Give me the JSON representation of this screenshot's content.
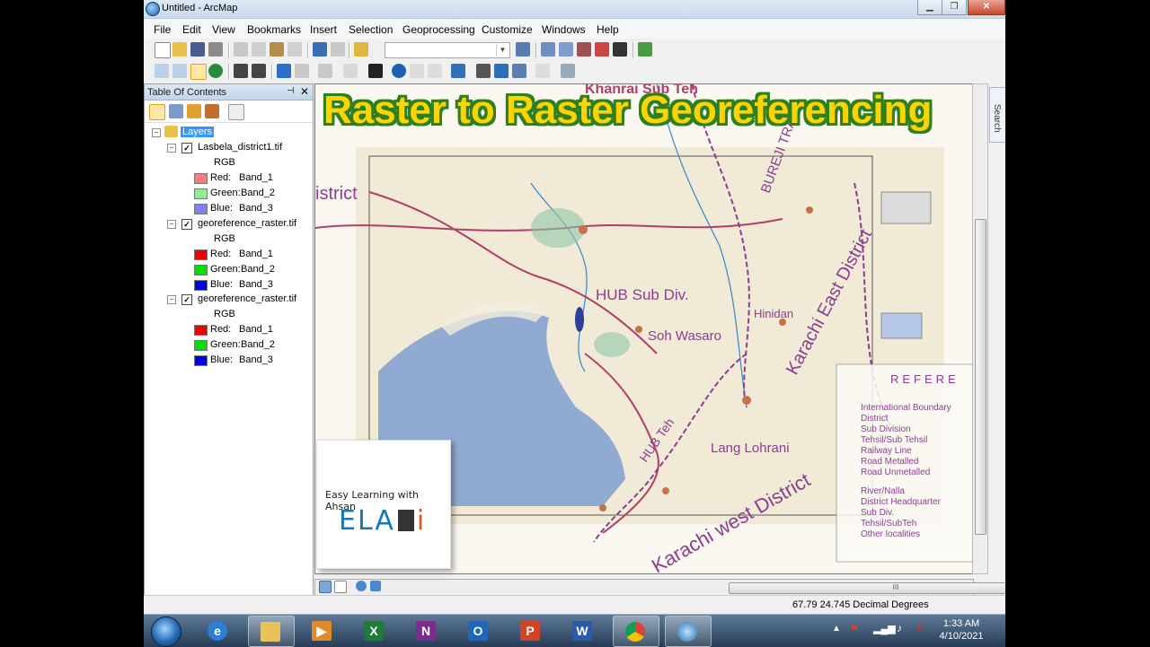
{
  "window": {
    "title": "Untitled - ArcMap",
    "minimize": "▁",
    "maximize": "❐",
    "close": "✕"
  },
  "menu": [
    "File",
    "Edit",
    "View",
    "Bookmarks",
    "Insert",
    "Selection",
    "Geoprocessing",
    "Customize",
    "Windows",
    "Help"
  ],
  "toc": {
    "title": "Table Of Contents",
    "pin": "⊣",
    "close": "✕",
    "root": "Layers",
    "layers": [
      {
        "name": "Lasbela_district1.tif",
        "renderer": "RGB",
        "bands": [
          {
            "label": "Red:",
            "band": "Band_1",
            "color": "#f08080"
          },
          {
            "label": "Green:",
            "band": "Band_2",
            "color": "#90ee90"
          },
          {
            "label": "Blue:",
            "band": "Band_3",
            "color": "#8080f0"
          }
        ]
      },
      {
        "name": "georeference_raster.tif",
        "renderer": "RGB",
        "bands": [
          {
            "label": "Red:",
            "band": "Band_1",
            "color": "#ee0000"
          },
          {
            "label": "Green:",
            "band": "Band_2",
            "color": "#00dd00"
          },
          {
            "label": "Blue:",
            "band": "Band_3",
            "color": "#0000dd"
          }
        ]
      },
      {
        "name": "georeference_raster.tif",
        "renderer": "RGB",
        "bands": [
          {
            "label": "Red:",
            "band": "Band_1",
            "color": "#ee0000"
          },
          {
            "label": "Green:",
            "band": "Band_2",
            "color": "#00dd00"
          },
          {
            "label": "Blue:",
            "band": "Band_3",
            "color": "#0000dd"
          }
        ]
      }
    ]
  },
  "map": {
    "banner": "Raster to Raster Georeferencing",
    "labels": {
      "khanrai": "Khanrai Sub Teh",
      "district": "istrict",
      "burejitrak": "BUREJI TRAK",
      "hub": "HUB Sub Div.",
      "sohwasaro": "Soh Wasaro",
      "hinidan": "Hinidan",
      "karachieast": "Karachi East District",
      "hubteh": "HUB Teh",
      "langlohrani": "Lang Lohrani",
      "karachiwest": "Karachi west District",
      "reference": "REFERE",
      "legend": [
        "International Boundary",
        "District",
        "Sub Division",
        "Tehsil/Sub Tehsil",
        "Railway Line",
        "Road Metalled",
        "Road Unmetalled",
        "River/Nalla",
        "District Headquarter",
        "Sub Div.",
        "Tehsil/SubTeh",
        "Other localities"
      ]
    }
  },
  "logo": {
    "line1": "Easy Learning with Ahsan",
    "line2": "ELA",
    "line2b": "i"
  },
  "search_tab": "Search",
  "scroll_grip": "III",
  "status": {
    "coordinates": "67.79  24.745 Decimal Degrees"
  },
  "taskbar": {
    "time": "1:33 AM",
    "date": "4/10/2021"
  },
  "colors": {
    "banner_fill": "#ffd400",
    "banner_outline": "#2f7f1f",
    "map_water": "#7f9fd1",
    "map_road": "#b0406a"
  }
}
